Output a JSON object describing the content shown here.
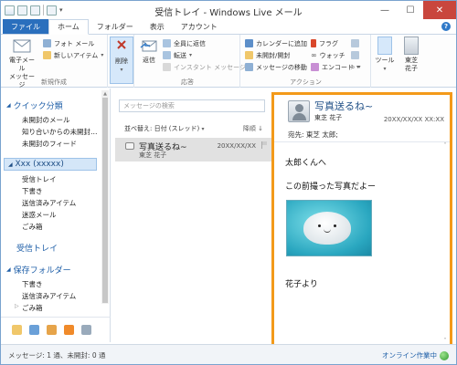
{
  "titlebar": {
    "title": "受信トレイ - Windows Live メール",
    "minimize": "—",
    "maximize": "☐",
    "close": "✕"
  },
  "tabs": [
    "ファイル",
    "ホーム",
    "フォルダー",
    "表示",
    "アカウント"
  ],
  "ribbon": {
    "new_group": {
      "label": "新規作成",
      "email_message": "電子メール\nメッセージ",
      "photo_email": "フォト メール",
      "new_item": "新しいアイテム"
    },
    "delete_group": {
      "delete": "削除"
    },
    "respond_group": {
      "label": "応答",
      "reply": "返信",
      "reply_all": "全員に返信",
      "forward": "転送",
      "instant_message": "インスタント メッセージ"
    },
    "actions_group": {
      "label": "アクション",
      "add_to_calendar": "カレンダーに追加",
      "unread_read": "未開封/開封",
      "move_to": "メッセージの移動",
      "flag": "フラグ",
      "watch": "ウォッチ",
      "encoding": "エンコード"
    },
    "tools": "ツール",
    "user": "東芝\n花子"
  },
  "leftnav": {
    "quick_views": "クイック分類",
    "quick_items": [
      "未開封のメール",
      "知り合いからの未開封…",
      "未開封のフィード"
    ],
    "account": "Xxx (xxxxx)",
    "account_items": [
      "受信トレイ",
      "下書き",
      "送信済みアイテム",
      "迷惑メール",
      "ごみ箱"
    ],
    "inbox_link": "受信トレイ",
    "storage": "保存フォルダー",
    "storage_items": [
      "下書き",
      "送信済みアイテム",
      "ごみ箱"
    ]
  },
  "msglist": {
    "search_placeholder": "メッセージの検索",
    "sort": "並べ替え: 日付 (スレッド)",
    "order": "降順",
    "message": {
      "subject": "写真送るね~",
      "from": "東芝 花子",
      "date": "20XX/XX/XX"
    }
  },
  "reading": {
    "subject": "写真送るね~",
    "from": "東芝 花子",
    "date": "20XX/XX/XX XX:XX",
    "to": "宛先: 東芝 太郎;",
    "lines": [
      "太郎くんへ",
      "この前撮った写真だよー",
      "花子より"
    ]
  },
  "status": {
    "left": "メッセージ: 1 通、未開封: 0 通",
    "right": "オンライン作業中"
  }
}
